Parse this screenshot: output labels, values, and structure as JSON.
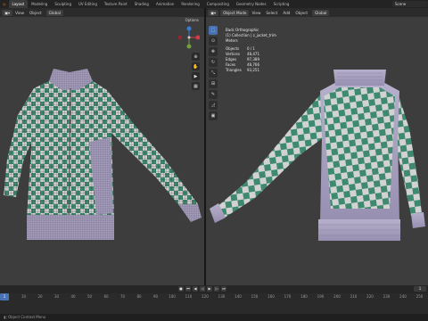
{
  "app": {
    "name": "Blender"
  },
  "topbar": {
    "tabs": [
      "Layout",
      "Modeling",
      "Sculpting",
      "UV Editing",
      "Texture Paint",
      "Shading",
      "Animation",
      "Rendering",
      "Compositing",
      "Geometry Nodes",
      "Scripting"
    ],
    "active_tab": "Layout",
    "scene": "Scene"
  },
  "left_viewport": {
    "header": {
      "view": "View",
      "object": "Object",
      "transform": "Global"
    },
    "options": "Options"
  },
  "right_viewport": {
    "header": {
      "mode": "Object Mode",
      "view": "View",
      "select": "Select",
      "add": "Add",
      "object": "Object",
      "transform": "Global"
    },
    "overlay": {
      "view_name": "Back Orthographic",
      "collection": "(1) Collection | z_jacket_trim",
      "units": "Meters",
      "stats": [
        {
          "label": "Objects",
          "value": "0 / 1"
        },
        {
          "label": "Vertices",
          "value": "48,471"
        },
        {
          "label": "Edges",
          "value": "97,389"
        },
        {
          "label": "Faces",
          "value": "48,766"
        },
        {
          "label": "Triangles",
          "value": "93,251"
        }
      ]
    }
  },
  "timeline": {
    "current_frame": "1",
    "ruler_labels": [
      "0",
      "10",
      "20",
      "30",
      "40",
      "50",
      "60",
      "70",
      "80",
      "90",
      "100",
      "110",
      "120",
      "130",
      "140",
      "150",
      "160",
      "170",
      "180",
      "190",
      "200",
      "210",
      "220",
      "230",
      "240",
      "250"
    ]
  },
  "statusbar": {
    "text": "Object Context Menu"
  },
  "colors": {
    "accent": "#4772b3",
    "check_green": "#3e8a70",
    "check_light": "#c8c8c8",
    "trim": "#a79fc0",
    "gizmo_x": "#d33b48",
    "gizmo_y": "#6ea13b",
    "gizmo_z": "#3b7ad3"
  }
}
